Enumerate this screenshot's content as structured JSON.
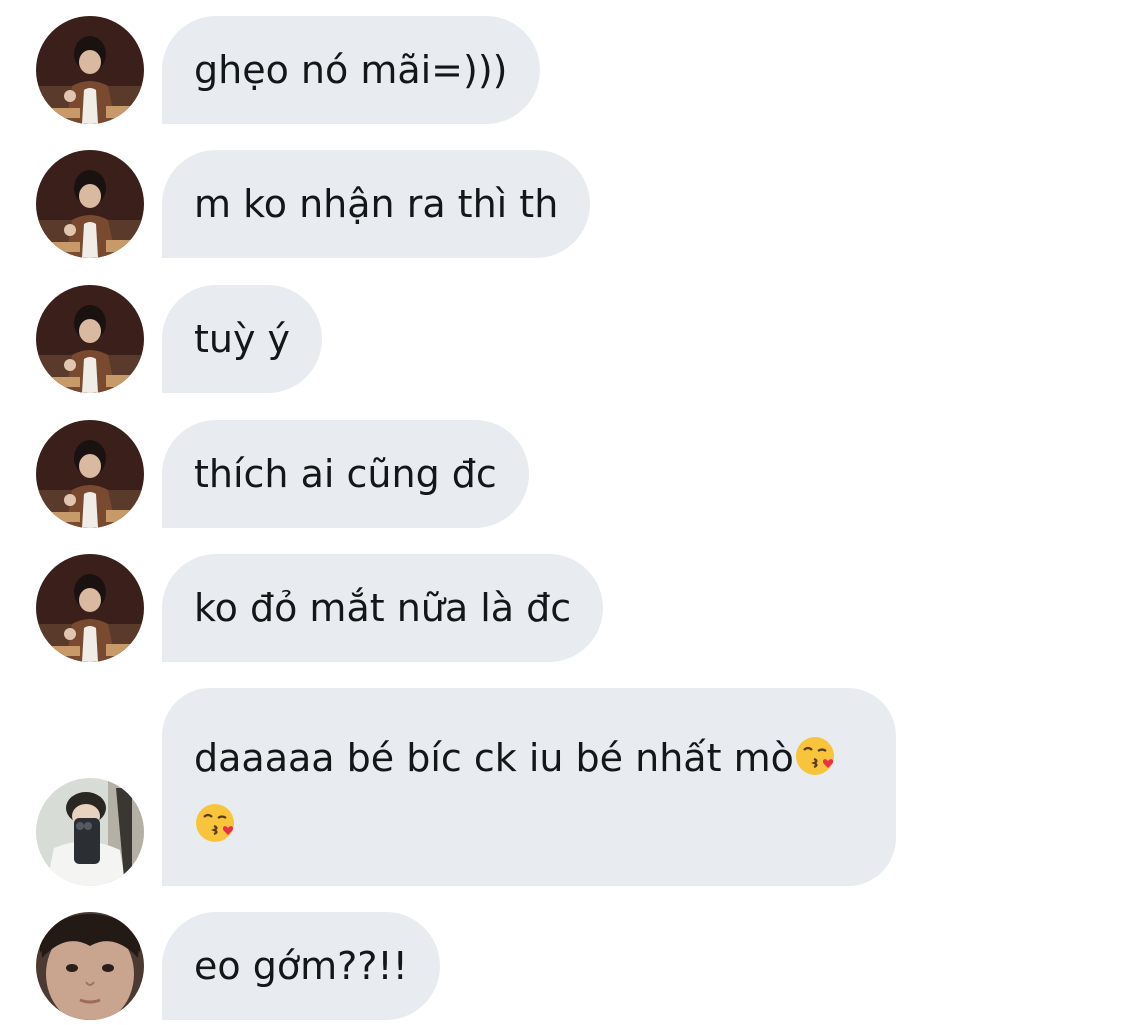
{
  "messages": [
    {
      "id": 1,
      "sender": "friend",
      "text": "ghẹo nó mãi=)))"
    },
    {
      "id": 2,
      "sender": "friend",
      "text": "m ko nhận ra thì th"
    },
    {
      "id": 3,
      "sender": "friend",
      "text": "tuỳ ý"
    },
    {
      "id": 4,
      "sender": "friend",
      "text": "thích ai cũng đc"
    },
    {
      "id": 5,
      "sender": "friend",
      "text": "ko đỏ mắt nữa là đc"
    },
    {
      "id": 6,
      "sender": "friend2",
      "text": "daaaaa bé bíc ck iu bé nhất mò",
      "emoji": [
        "😘",
        "😘"
      ]
    },
    {
      "id": 7,
      "sender": "friend3",
      "text": "eo gớm??!!"
    }
  ],
  "colors": {
    "bubble_bg": "#e8ecf0",
    "text": "#14171a",
    "background": "#ffffff"
  },
  "icons": {
    "avatar_1": "profile-photo-dark-icon",
    "avatar_2": "profile-photo-mirror-selfie-icon",
    "avatar_3": "profile-photo-closeup-icon",
    "emoji": "kiss-face-emoji"
  }
}
